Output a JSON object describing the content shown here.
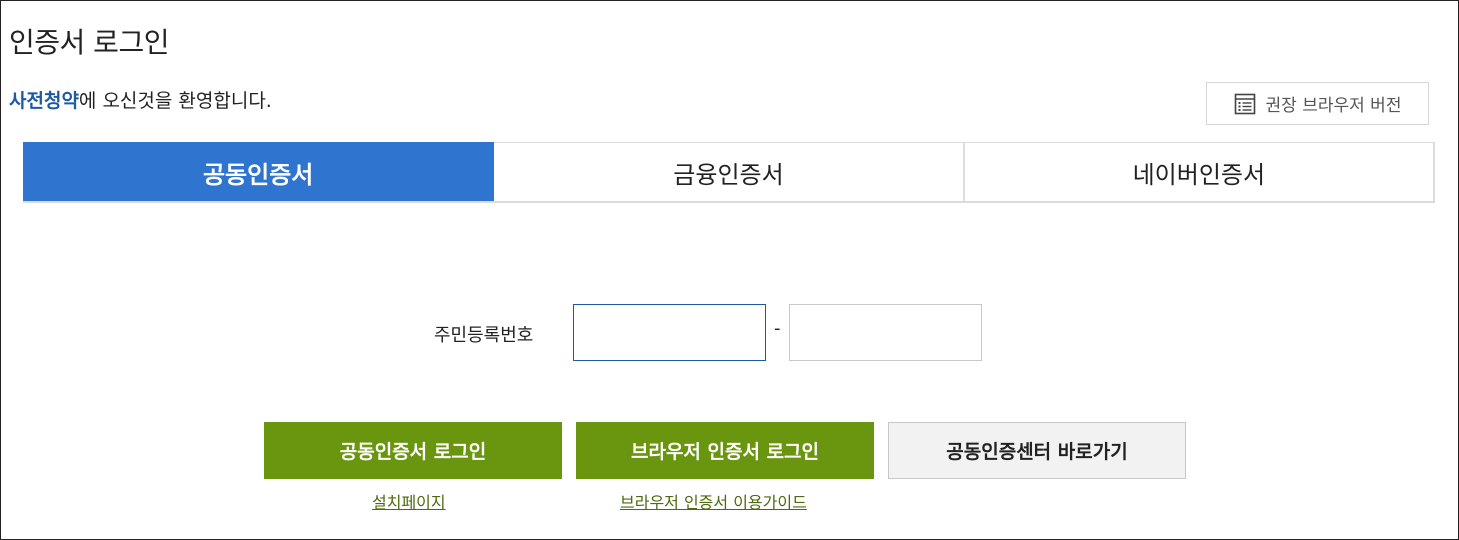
{
  "header": {
    "title": "인증서 로그인",
    "welcome_brand": "사전청약",
    "welcome_rest": "에 오신것을 환영합니다.",
    "browser_version_label": "권장 브라우저 버전",
    "browser_version_icon": "list-icon"
  },
  "tabs": [
    {
      "label": "공동인증서",
      "active": true
    },
    {
      "label": "금융인증서",
      "active": false
    },
    {
      "label": "네이버인증서",
      "active": false
    }
  ],
  "form": {
    "rrn_label": "주민등록번호",
    "rrn_first_value": "",
    "rrn_separator": "-",
    "rrn_second_value": ""
  },
  "buttons": {
    "joint_cert_login": "공동인증서 로그인",
    "browser_cert_login": "브라우저 인증서 로그인",
    "joint_cert_center": "공동인증센터 바로가기"
  },
  "links": {
    "install_page": "설치페이지",
    "browser_cert_guide": "브라우저 인증서 이용가이드"
  },
  "colors": {
    "active_tab": "#2f75cf",
    "primary_button": "#6a950f",
    "brand_text": "#1b5aa5"
  }
}
